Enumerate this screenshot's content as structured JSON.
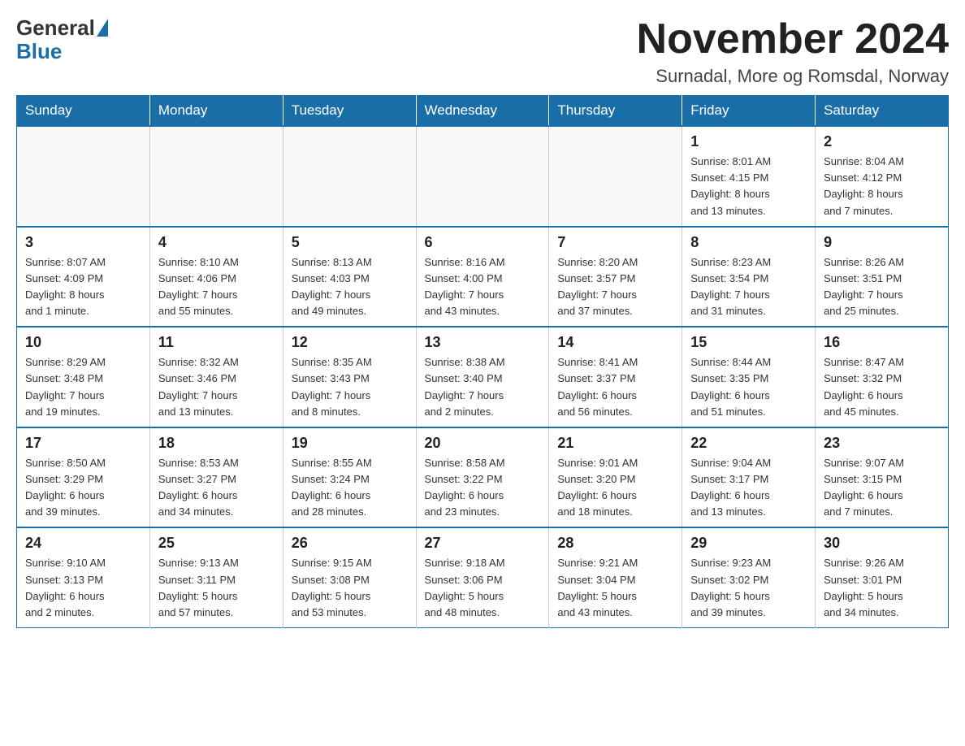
{
  "logo": {
    "general": "General",
    "blue": "Blue"
  },
  "title": "November 2024",
  "location": "Surnadal, More og Romsdal, Norway",
  "weekdays": [
    "Sunday",
    "Monday",
    "Tuesday",
    "Wednesday",
    "Thursday",
    "Friday",
    "Saturday"
  ],
  "weeks": [
    [
      {
        "day": "",
        "info": ""
      },
      {
        "day": "",
        "info": ""
      },
      {
        "day": "",
        "info": ""
      },
      {
        "day": "",
        "info": ""
      },
      {
        "day": "",
        "info": ""
      },
      {
        "day": "1",
        "info": "Sunrise: 8:01 AM\nSunset: 4:15 PM\nDaylight: 8 hours\nand 13 minutes."
      },
      {
        "day": "2",
        "info": "Sunrise: 8:04 AM\nSunset: 4:12 PM\nDaylight: 8 hours\nand 7 minutes."
      }
    ],
    [
      {
        "day": "3",
        "info": "Sunrise: 8:07 AM\nSunset: 4:09 PM\nDaylight: 8 hours\nand 1 minute."
      },
      {
        "day": "4",
        "info": "Sunrise: 8:10 AM\nSunset: 4:06 PM\nDaylight: 7 hours\nand 55 minutes."
      },
      {
        "day": "5",
        "info": "Sunrise: 8:13 AM\nSunset: 4:03 PM\nDaylight: 7 hours\nand 49 minutes."
      },
      {
        "day": "6",
        "info": "Sunrise: 8:16 AM\nSunset: 4:00 PM\nDaylight: 7 hours\nand 43 minutes."
      },
      {
        "day": "7",
        "info": "Sunrise: 8:20 AM\nSunset: 3:57 PM\nDaylight: 7 hours\nand 37 minutes."
      },
      {
        "day": "8",
        "info": "Sunrise: 8:23 AM\nSunset: 3:54 PM\nDaylight: 7 hours\nand 31 minutes."
      },
      {
        "day": "9",
        "info": "Sunrise: 8:26 AM\nSunset: 3:51 PM\nDaylight: 7 hours\nand 25 minutes."
      }
    ],
    [
      {
        "day": "10",
        "info": "Sunrise: 8:29 AM\nSunset: 3:48 PM\nDaylight: 7 hours\nand 19 minutes."
      },
      {
        "day": "11",
        "info": "Sunrise: 8:32 AM\nSunset: 3:46 PM\nDaylight: 7 hours\nand 13 minutes."
      },
      {
        "day": "12",
        "info": "Sunrise: 8:35 AM\nSunset: 3:43 PM\nDaylight: 7 hours\nand 8 minutes."
      },
      {
        "day": "13",
        "info": "Sunrise: 8:38 AM\nSunset: 3:40 PM\nDaylight: 7 hours\nand 2 minutes."
      },
      {
        "day": "14",
        "info": "Sunrise: 8:41 AM\nSunset: 3:37 PM\nDaylight: 6 hours\nand 56 minutes."
      },
      {
        "day": "15",
        "info": "Sunrise: 8:44 AM\nSunset: 3:35 PM\nDaylight: 6 hours\nand 51 minutes."
      },
      {
        "day": "16",
        "info": "Sunrise: 8:47 AM\nSunset: 3:32 PM\nDaylight: 6 hours\nand 45 minutes."
      }
    ],
    [
      {
        "day": "17",
        "info": "Sunrise: 8:50 AM\nSunset: 3:29 PM\nDaylight: 6 hours\nand 39 minutes."
      },
      {
        "day": "18",
        "info": "Sunrise: 8:53 AM\nSunset: 3:27 PM\nDaylight: 6 hours\nand 34 minutes."
      },
      {
        "day": "19",
        "info": "Sunrise: 8:55 AM\nSunset: 3:24 PM\nDaylight: 6 hours\nand 28 minutes."
      },
      {
        "day": "20",
        "info": "Sunrise: 8:58 AM\nSunset: 3:22 PM\nDaylight: 6 hours\nand 23 minutes."
      },
      {
        "day": "21",
        "info": "Sunrise: 9:01 AM\nSunset: 3:20 PM\nDaylight: 6 hours\nand 18 minutes."
      },
      {
        "day": "22",
        "info": "Sunrise: 9:04 AM\nSunset: 3:17 PM\nDaylight: 6 hours\nand 13 minutes."
      },
      {
        "day": "23",
        "info": "Sunrise: 9:07 AM\nSunset: 3:15 PM\nDaylight: 6 hours\nand 7 minutes."
      }
    ],
    [
      {
        "day": "24",
        "info": "Sunrise: 9:10 AM\nSunset: 3:13 PM\nDaylight: 6 hours\nand 2 minutes."
      },
      {
        "day": "25",
        "info": "Sunrise: 9:13 AM\nSunset: 3:11 PM\nDaylight: 5 hours\nand 57 minutes."
      },
      {
        "day": "26",
        "info": "Sunrise: 9:15 AM\nSunset: 3:08 PM\nDaylight: 5 hours\nand 53 minutes."
      },
      {
        "day": "27",
        "info": "Sunrise: 9:18 AM\nSunset: 3:06 PM\nDaylight: 5 hours\nand 48 minutes."
      },
      {
        "day": "28",
        "info": "Sunrise: 9:21 AM\nSunset: 3:04 PM\nDaylight: 5 hours\nand 43 minutes."
      },
      {
        "day": "29",
        "info": "Sunrise: 9:23 AM\nSunset: 3:02 PM\nDaylight: 5 hours\nand 39 minutes."
      },
      {
        "day": "30",
        "info": "Sunrise: 9:26 AM\nSunset: 3:01 PM\nDaylight: 5 hours\nand 34 minutes."
      }
    ]
  ]
}
